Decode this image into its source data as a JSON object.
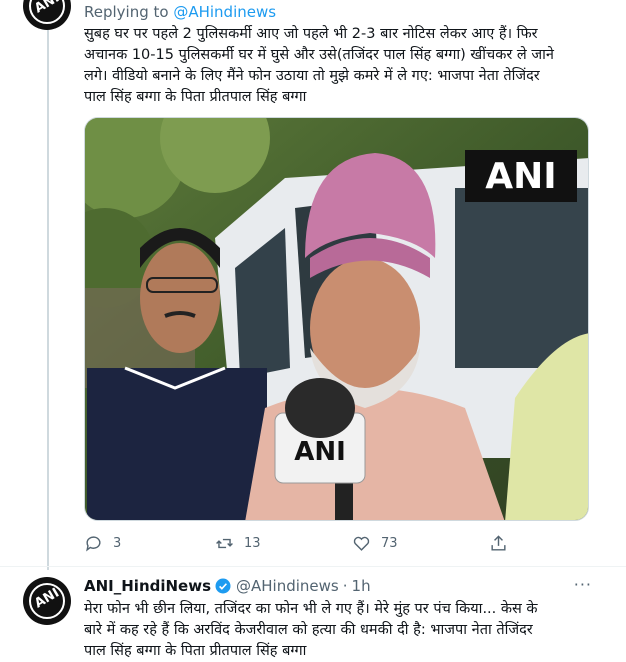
{
  "tweet1": {
    "replying_prefix": "Replying to ",
    "replying_handle": "@AHindinews",
    "text_lines": [
      "सुबह घर पर पहले 2 पुलिसकर्मी आए जो पहले भी 2-3 बार नोटिस लेकर आए हैं। फिर",
      "अचानक 10-15 पुलिसकर्मी घर में घुसे और उसे(तजिंदर पाल सिंह बग्गा) खींचकर ले जाने",
      "लगे। वीडियो बनाने के लिए मैंने फोन उठाया तो मुझे कमरे में ले गए: भाजपा नेता तेजिंदर",
      "पाल सिंह बग्गा के पिता प्रीतपाल सिंह बग्गा"
    ],
    "watermark": "ANI",
    "mic_label": "ANI",
    "avatar_text": "ANI",
    "actions": {
      "replies": "3",
      "retweets": "13",
      "likes": "73"
    }
  },
  "tweet2": {
    "avatar_text": "ANI",
    "name": "ANI_HindiNews",
    "handle": "@AHindinews",
    "separator": "·",
    "time": "1h",
    "more": "···",
    "text_lines": [
      "मेरा फोन भी छीन लिया, तजिंदर का फोन भी ले गए हैं। मेरे मुंह पर पंच किया... केस के",
      "बारे में कह रहे हैं कि अरविंद केजरीवाल को हत्या की धमकी दी है: भाजपा नेता तेजिंदर",
      "पाल सिंह बग्गा के पिता प्रीतपाल सिंह बग्गा"
    ]
  },
  "colors": {
    "accent": "#1d9bf0",
    "muted": "#536471",
    "text": "#0f1419",
    "border": "#cfd9de"
  },
  "icons": [
    "reply-icon",
    "retweet-icon",
    "like-icon",
    "share-icon",
    "verified-badge-icon",
    "more-icon"
  ]
}
